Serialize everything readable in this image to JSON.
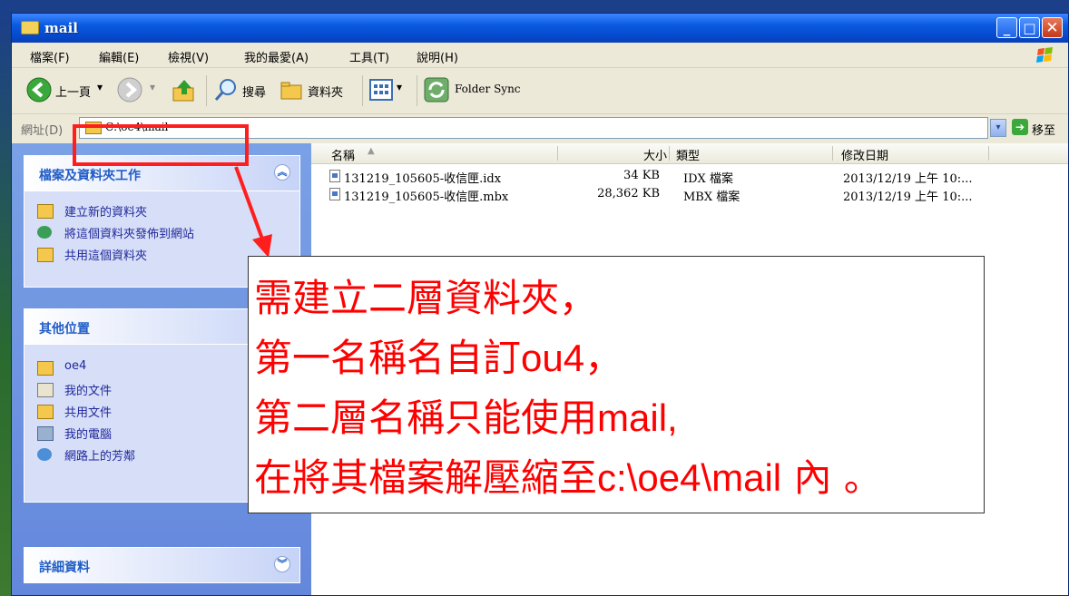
{
  "window": {
    "title": "mail",
    "minimize": "_",
    "maximize": "□",
    "close": "✕"
  },
  "menu": [
    "檔案(F)",
    "編輯(E)",
    "檢視(V)",
    "我的最愛(A)",
    "工具(T)",
    "說明(H)"
  ],
  "toolbar": {
    "back": "上一頁",
    "search": "搜尋",
    "folders": "資料夾",
    "folder_sync": "Folder Sync",
    "dropdown": "▾"
  },
  "address": {
    "label": "網址(D)",
    "value": "C:\\oe4\\mail",
    "go": "移至"
  },
  "sidebar": {
    "tasks": {
      "title": "檔案及資料夾工作",
      "items": [
        "建立新的資料夾",
        "將這個資料夾發佈到網站",
        "共用這個資料夾"
      ]
    },
    "other_places": {
      "title": "其他位置",
      "items": [
        "oe4",
        "我的文件",
        "共用文件",
        "我的電腦",
        "網路上的芳鄰"
      ]
    },
    "details": {
      "title": "詳細資料"
    }
  },
  "columns": {
    "name": "名稱",
    "size": "大小",
    "type": "類型",
    "modified": "修改日期"
  },
  "files": [
    {
      "name": "131219_105605-收信匣.idx",
      "size": "34 KB",
      "type": "IDX 檔案",
      "modified": "2013/12/19 上午 10:..."
    },
    {
      "name": "131219_105605-收信匣.mbx",
      "size": "28,362 KB",
      "type": "MBX 檔案",
      "modified": "2013/12/19 上午 10:..."
    }
  ],
  "annotation": {
    "line1": "需建立二層資料夾，",
    "line2_a": "第一名稱名自訂",
    "line2_b": "ou4",
    "line2_c": "，",
    "line3_a": "第二層名稱只能使用",
    "line3_b": "mail,",
    "line4_a": "在將其檔案解壓縮至",
    "line4_b": "c:\\oe4\\mail",
    "line4_c": " 內 。"
  },
  "colors": {
    "annotation_red": "#ff0000",
    "highlight": "#ff1e1e",
    "task_link": "#21279c",
    "panel_title": "#215dc6"
  }
}
